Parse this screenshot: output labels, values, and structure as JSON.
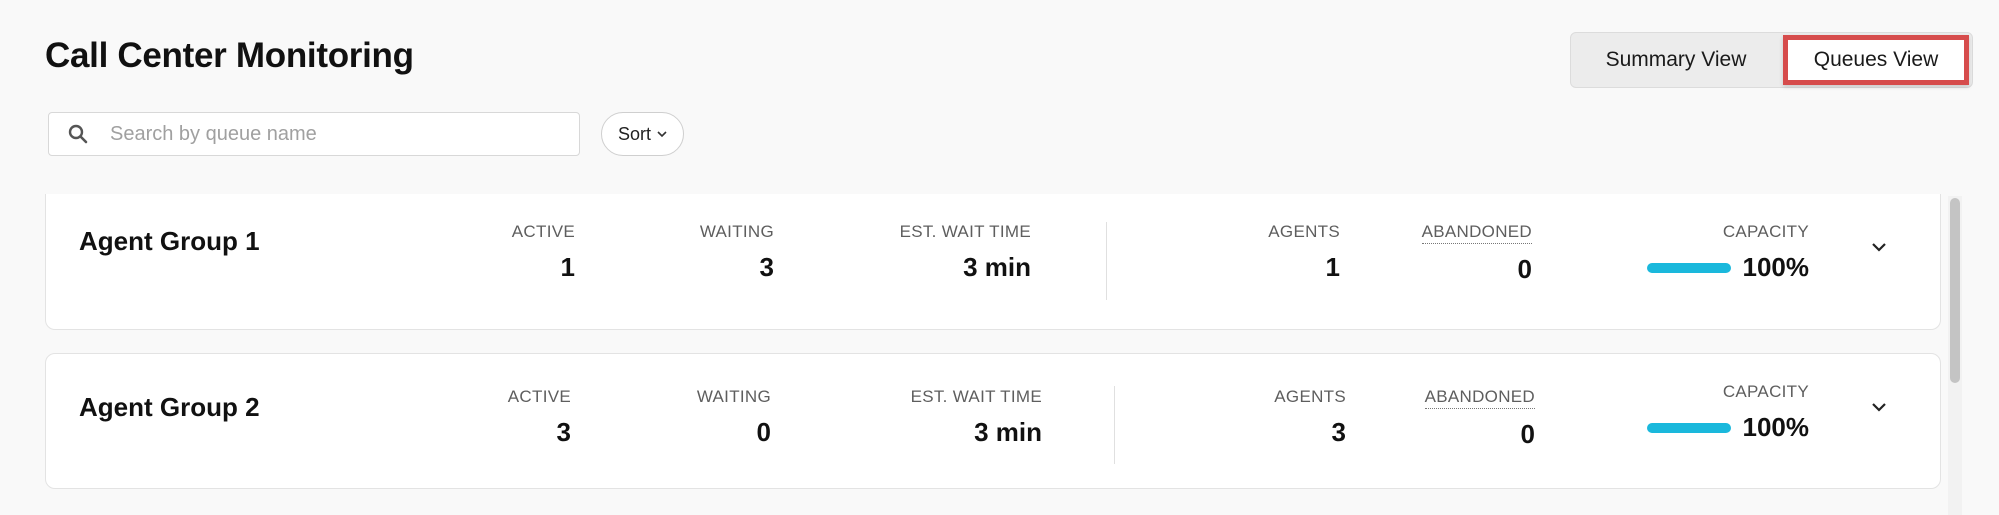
{
  "page": {
    "title": "Call Center Monitoring"
  },
  "view_toggle": {
    "summary_label": "Summary View",
    "queues_label": "Queues View",
    "selected": "Queues View"
  },
  "search": {
    "placeholder": "Search by queue name",
    "value": ""
  },
  "sort": {
    "label": "Sort"
  },
  "labels": {
    "active": "ACTIVE",
    "waiting": "WAITING",
    "est_wait": "EST. WAIT TIME",
    "agents": "AGENTS",
    "abandoned": "ABANDONED",
    "capacity": "CAPACITY"
  },
  "groups": [
    {
      "name": "Agent Group 1",
      "active": "1",
      "waiting": "3",
      "est_wait": "3 min",
      "agents": "1",
      "abandoned": "0",
      "capacity": "100%",
      "capacity_fraction": 1.0
    },
    {
      "name": "Agent Group 2",
      "active": "3",
      "waiting": "0",
      "est_wait": "3 min",
      "agents": "3",
      "abandoned": "0",
      "capacity": "100%",
      "capacity_fraction": 1.0
    }
  ],
  "colors": {
    "accent": "#1ab8dc",
    "highlight_border": "#d64c4c"
  }
}
